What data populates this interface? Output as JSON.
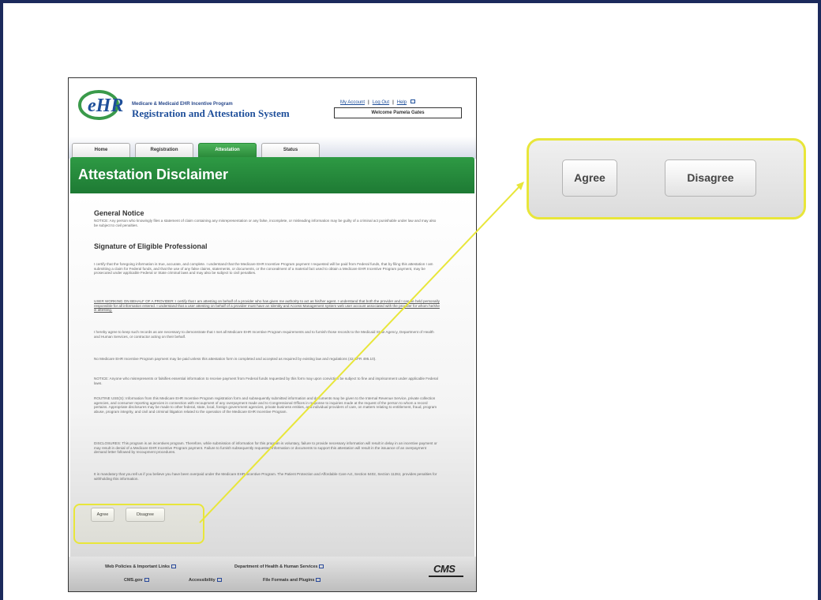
{
  "header": {
    "program_name": "Medicare & Medicaid EHR Incentive Program",
    "system_title": "Registration and Attestation System",
    "logo_text": "EHR",
    "links": [
      "My Account",
      "Log Out",
      "Help"
    ],
    "welcome": "Welcome Pamela Gates"
  },
  "tabs": [
    "Home",
    "Registration",
    "Attestation",
    "Status"
  ],
  "active_tab": "Attestation",
  "page_title": "Attestation Disclaimer",
  "sections": {
    "general_notice_heading": "General Notice",
    "general_notice_text": "NOTICE: Any person who knowingly files a statement of claim containing any misrepresentation or any false, incomplete, or misleading information may be guilty of a criminal act punishable under law and may also be subject to civil penalties.",
    "signature_heading": "Signature of Eligible Professional",
    "paragraphs": [
      "I certify that the foregoing information is true, accurate, and complete. I understand that the Medicare EHR Incentive Program payment I requested will be paid from Federal funds, that by filing this attestation I am submitting a claim for Federal funds, and that the use of any false claims, statements, or documents, or the concealment of a material fact used to obtain a Medicare EHR Incentive Program payment, may be prosecuted under applicable Federal or State criminal laws and may also be subject to civil penalties.",
      "USER WORKING ON BEHALF OF A PROVIDER: I certify that I am attesting on behalf of a provider who has given me authority to act as his/her agent. I understand that both the provider and I can be held personally responsible for all information entered. I understand that a user attesting on behalf of a provider must have an Identity and Access Management system web user account associated with the provider for whom he/she is attesting.",
      "I hereby agree to keep such records as are necessary to demonstrate that I met all Medicare EHR Incentive Program requirements and to furnish those records to the Medicaid State Agency, Department of Health and Human Services, or contractor acting on their behalf.",
      "No Medicare EHR Incentive Program payment may be paid unless this attestation form is completed and accepted as required by existing law and regulations (42 CFR 495.10).",
      "NOTICE: Anyone who misrepresents or falsifies essential information to receive payment from Federal funds requested by this form may upon conviction be subject to fine and imprisonment under applicable Federal laws.",
      "ROUTINE USE(S): Information from this Medicare EHR Incentive Program registration form and subsequently submitted information and documents may be given to the Internal Revenue Service, private collection agencies, and consumer reporting agencies in connection with recoupment of any overpayment made and to Congressional Offices in response to inquiries made at the request of the person to whom a record pertains. Appropriate disclosures may be made to other federal, state, local, foreign government agencies, private business entities, and individual providers of care, on matters relating to entitlement, fraud, program abuse, program integrity, and civil and criminal litigation related to the operation of the Medicare EHR Incentive Program.",
      "DISCLOSURES: This program is an incentives program. Therefore, while submission of information for this program is voluntary, failure to provide necessary information will result in delay in an incentive payment or may result in denial of a Medicare EHR Incentive Program payment. Failure to furnish subsequently requested information or documents to support this attestation will result in the issuance of an overpayment demand letter followed by recoupment procedures.",
      "It is mandatory that you tell us if you believe you have been overpaid under the Medicare EHR Incentive Program. The Patient Protection and Affordable Care Act, Section 6402, Section 1128J, provides penalties for withholding this information."
    ]
  },
  "buttons": {
    "agree": "Agree",
    "disagree": "Disagree"
  },
  "footer": {
    "links": [
      "Web Policies & Important Links",
      "Department of Health & Human Services",
      "CMS.gov",
      "Accessibility",
      "File Formats and Plugins"
    ],
    "logo": "CMS"
  },
  "colors": {
    "frame": "#1c2a5c",
    "green": "#2e9a44",
    "highlight": "#e8e63a",
    "link": "#1f4f9a"
  }
}
